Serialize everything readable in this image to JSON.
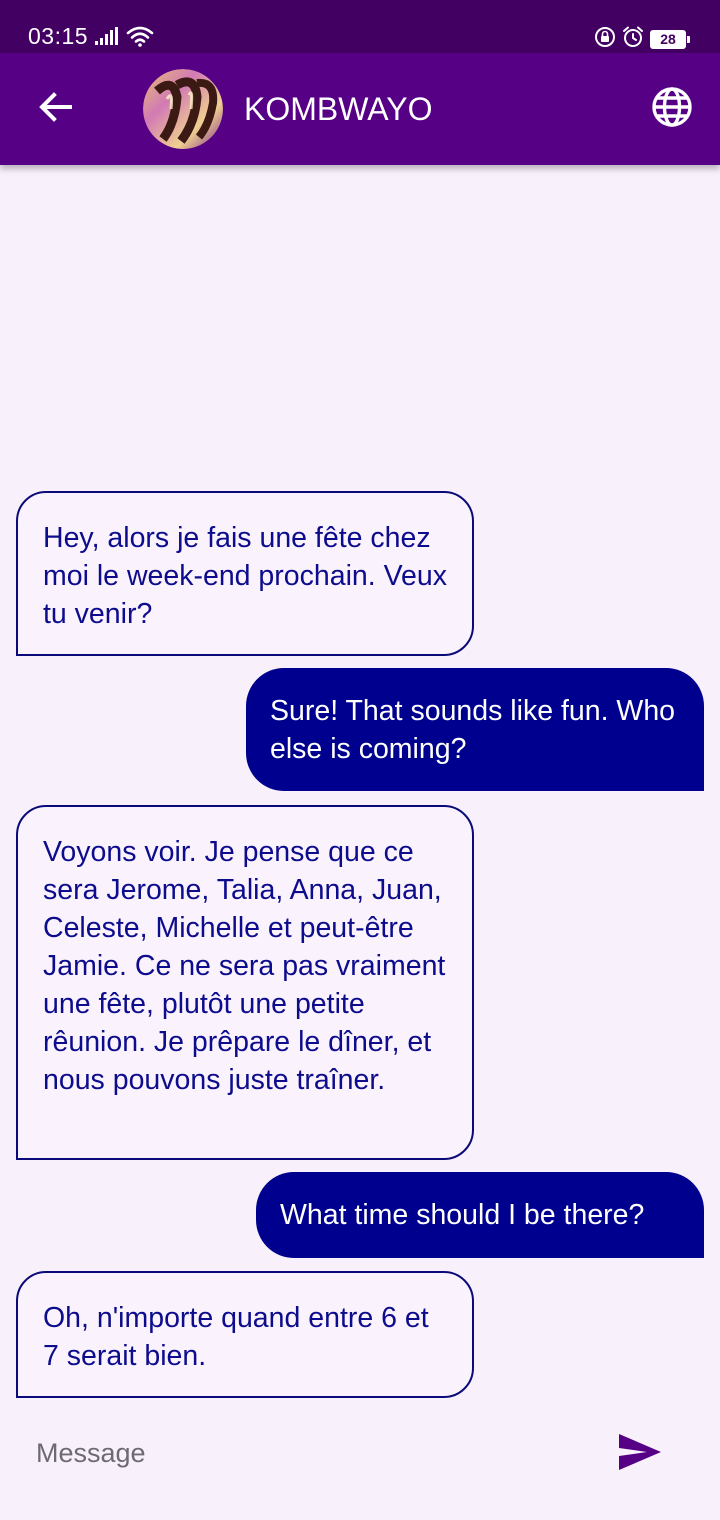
{
  "status_bar": {
    "time": "03:15",
    "battery_level": "28",
    "icons": [
      "signal-icon",
      "wifi-icon",
      "screen-lock-icon",
      "alarm-icon",
      "battery-icon"
    ]
  },
  "header": {
    "title": "KOMBWAYO",
    "back_icon": "arrow-back-icon",
    "translate_icon": "globe-icon",
    "avatar": "avatar"
  },
  "colors": {
    "status_bar": "#420063",
    "app_bar": "#560086",
    "background": "#f8f0fb",
    "sent_bubble": "#00008e",
    "received_text": "#0c0c8c",
    "received_border": "#0a0a78",
    "send_icon": "#560086"
  },
  "messages": [
    {
      "direction": "received",
      "text": "Hey, alors je fais une fête chez moi le week-end prochain. Veux tu venir?"
    },
    {
      "direction": "sent",
      "text": "Sure! That sounds like fun. Who else is coming?"
    },
    {
      "direction": "received",
      "text": "Voyons voir. Je pense que ce sera Jerome, Talia, Anna, Juan, Celeste, Michelle et peut-être Jamie. Ce ne sera pas vraiment une fête, plutôt une petite rêunion. Je prêpare le dîner, et nous pouvons juste traîner."
    },
    {
      "direction": "sent",
      "text": "What time should I be there?"
    },
    {
      "direction": "received",
      "text": "Oh, n'importe quand entre 6 et 7 serait bien."
    }
  ],
  "composer": {
    "placeholder": "Message",
    "value": "",
    "send_icon": "send-icon"
  }
}
